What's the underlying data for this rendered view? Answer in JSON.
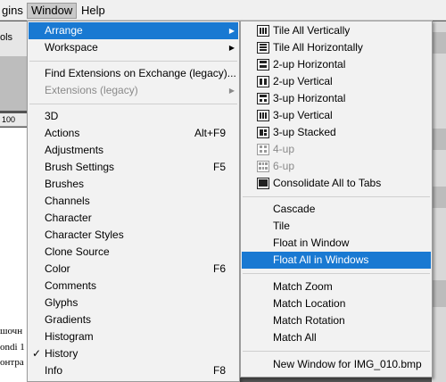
{
  "menubar": {
    "items": [
      "gins",
      "Window",
      "Help"
    ]
  },
  "app": {
    "options_label": "ols",
    "ruler_label": "100",
    "doc_lines": [
      "шочн",
      "ondi 1",
      "онтра"
    ]
  },
  "window_menu": {
    "items": [
      {
        "label": "Arrange",
        "submenu": true,
        "highlighted": true
      },
      {
        "label": "Workspace",
        "submenu": true
      },
      {
        "label": "Find Extensions on Exchange (legacy)..."
      },
      {
        "label": "Extensions (legacy)",
        "submenu": true,
        "disabled": true
      },
      {
        "label": "3D"
      },
      {
        "label": "Actions",
        "shortcut": "Alt+F9"
      },
      {
        "label": "Adjustments"
      },
      {
        "label": "Brush Settings",
        "shortcut": "F5"
      },
      {
        "label": "Brushes"
      },
      {
        "label": "Channels"
      },
      {
        "label": "Character"
      },
      {
        "label": "Character Styles"
      },
      {
        "label": "Clone Source"
      },
      {
        "label": "Color",
        "shortcut": "F6"
      },
      {
        "label": "Comments"
      },
      {
        "label": "Glyphs"
      },
      {
        "label": "Gradients"
      },
      {
        "label": "Histogram"
      },
      {
        "label": "History",
        "checked": true
      },
      {
        "label": "Info",
        "shortcut": "F8"
      }
    ]
  },
  "arrange_menu": {
    "items": [
      {
        "label": "Tile All Vertically",
        "icon": "tile-vertical-icon"
      },
      {
        "label": "Tile All Horizontally",
        "icon": "tile-horizontal-icon"
      },
      {
        "label": "2-up Horizontal",
        "icon": "two-up-horizontal-icon"
      },
      {
        "label": "2-up Vertical",
        "icon": "two-up-vertical-icon"
      },
      {
        "label": "3-up Horizontal",
        "icon": "three-up-horizontal-icon"
      },
      {
        "label": "3-up Vertical",
        "icon": "three-up-vertical-icon"
      },
      {
        "label": "3-up Stacked",
        "icon": "three-up-stacked-icon"
      },
      {
        "label": "4-up",
        "icon": "four-up-icon",
        "disabled": true
      },
      {
        "label": "6-up",
        "icon": "six-up-icon",
        "disabled": true
      },
      {
        "label": "Consolidate All to Tabs",
        "icon": "consolidate-tabs-icon"
      },
      {
        "label": "Cascade"
      },
      {
        "label": "Tile"
      },
      {
        "label": "Float in Window"
      },
      {
        "label": "Float All in Windows",
        "highlighted": true
      },
      {
        "label": "Match Zoom"
      },
      {
        "label": "Match Location"
      },
      {
        "label": "Match Rotation"
      },
      {
        "label": "Match All"
      },
      {
        "label": "New Window for IMG_010.bmp"
      }
    ]
  },
  "glyphs": {
    "submenu_arrow": "▶",
    "check": "✓"
  },
  "colors": {
    "highlight": "#1979d2",
    "menu_bg": "#f2f2f2",
    "disabled": "#8a8a8a"
  }
}
